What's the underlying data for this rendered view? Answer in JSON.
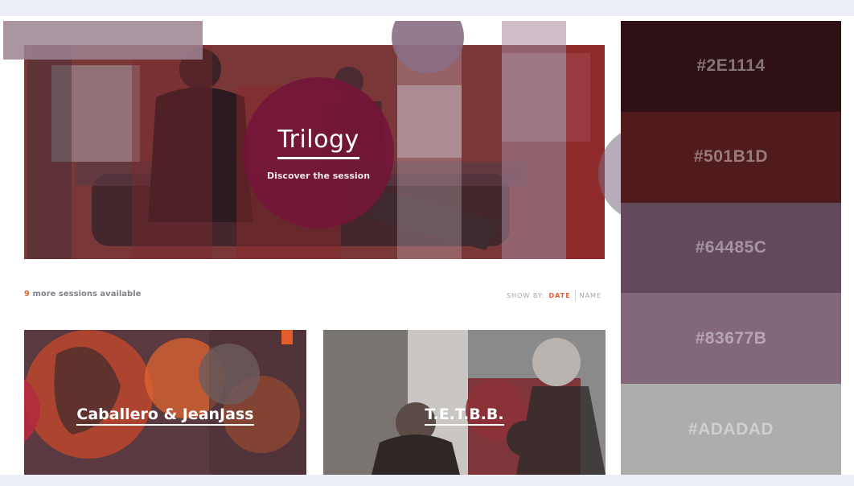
{
  "hero": {
    "title": "Trilogy",
    "subtitle": "Discover the session"
  },
  "sessions": {
    "count": "9",
    "count_suffix": " more sessions available",
    "show_by_label": "SHOW BY:",
    "sort_options": [
      "DATE",
      "NAME"
    ],
    "active_sort": "DATE"
  },
  "cards": [
    {
      "label": "Caballero & JeanJass"
    },
    {
      "label": "T.E.T.B.B."
    }
  ],
  "palette": [
    {
      "hex": "#2E1114"
    },
    {
      "hex": "#501B1D"
    },
    {
      "hex": "#64485C"
    },
    {
      "hex": "#83677B"
    },
    {
      "hex": "#ADADAD"
    }
  ],
  "colors": {
    "accent": "#E3622F",
    "hero_circle": "#731638"
  }
}
